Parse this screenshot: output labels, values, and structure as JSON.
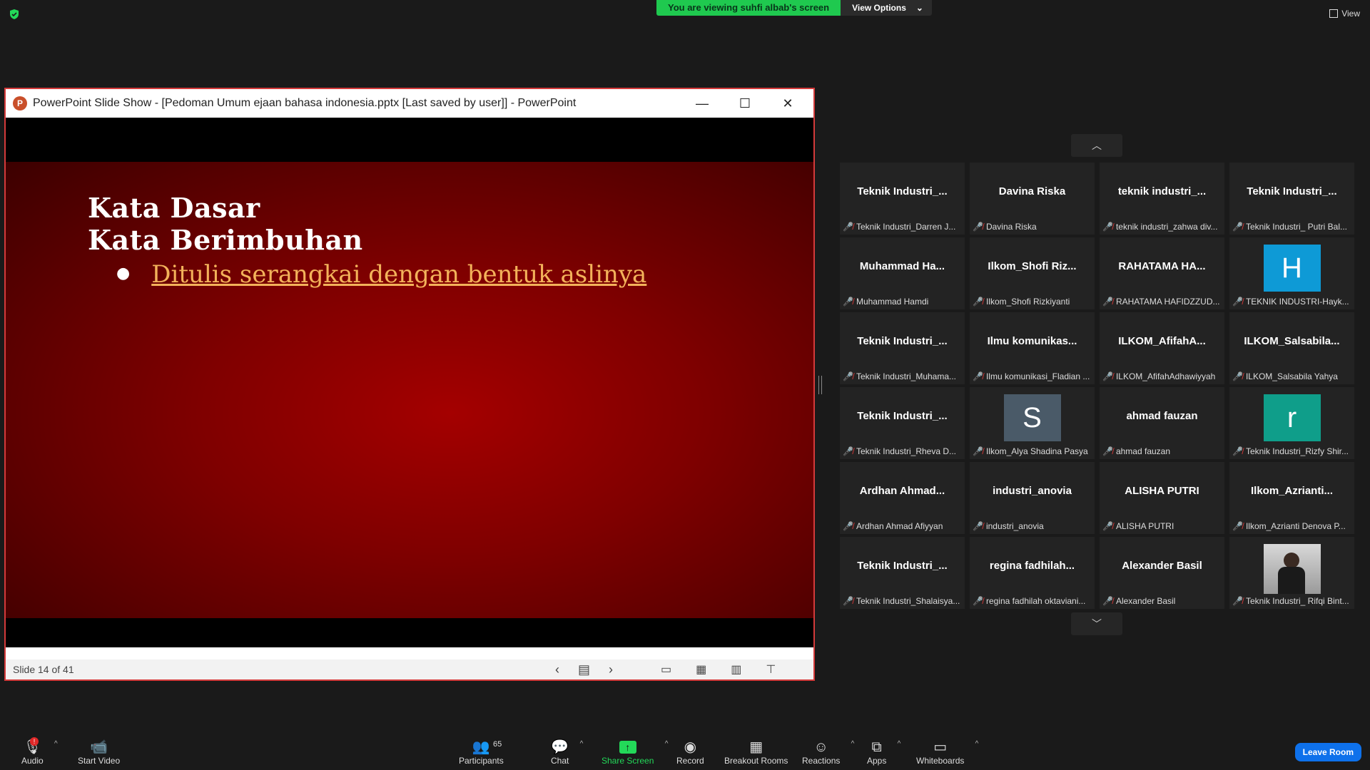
{
  "top": {
    "banner": "You are viewing suhfi albab's screen",
    "view_options": "View Options",
    "view": "View"
  },
  "ppt": {
    "title": "PowerPoint Slide Show - [Pedoman Umum ejaan bahasa indonesia.pptx [Last saved by user]] - PowerPoint",
    "slide_heading_1": "Kata Dasar",
    "slide_heading_2": "Kata Berimbuhan",
    "slide_bullet": "Ditulis serangkai dengan bentuk aslinya",
    "status": "Slide 14 of 41"
  },
  "gallery": [
    {
      "display": "Teknik  Industri_...",
      "name": "Teknik Industri_Darren J..."
    },
    {
      "display": "Davina Riska",
      "name": "Davina Riska"
    },
    {
      "display": "teknik  industri_...",
      "name": "teknik industri_zahwa div..."
    },
    {
      "display": "Teknik  Industri_...",
      "name": "Teknik Industri_ Putri Bal..."
    },
    {
      "display": "Muhammad  Ha...",
      "name": "Muhammad Hamdi"
    },
    {
      "display": "Ilkom_Shofi  Riz...",
      "name": "Ilkom_Shofi Rizkiyanti"
    },
    {
      "display": "RAHATAMA  HA...",
      "name": "RAHATAMA HAFIDZZUD..."
    },
    {
      "display": "",
      "name": "TEKNIK INDUSTRI-Hayk...",
      "avatar": "H",
      "color": "#0e9ad6"
    },
    {
      "display": "Teknik  Industri_...",
      "name": "Teknik Industri_Muhama..."
    },
    {
      "display": "Ilmu  komunikas...",
      "name": "Ilmu komunikasi_Fladian ..."
    },
    {
      "display": "ILKOM_AfifahA...",
      "name": "ILKOM_AfifahAdhawiyyah"
    },
    {
      "display": "ILKOM_Salsabila...",
      "name": "ILKOM_Salsabila Yahya"
    },
    {
      "display": "Teknik  Industri_...",
      "name": "Teknik Industri_Rheva D..."
    },
    {
      "display": "",
      "name": "Ilkom_Alya Shadina Pasya",
      "avatar": "S",
      "color": "#4a5a68"
    },
    {
      "display": "ahmad fauzan",
      "name": "ahmad fauzan"
    },
    {
      "display": "",
      "name": "Teknik Industri_Rizfy Shir...",
      "avatar": "r",
      "color": "#0f9e8a"
    },
    {
      "display": "Ardhan  Ahmad...",
      "name": "Ardhan Ahmad Afiyyan"
    },
    {
      "display": "industri_anovia",
      "name": "industri_anovia"
    },
    {
      "display": "ALISHA PUTRI",
      "name": "ALISHA PUTRI"
    },
    {
      "display": "Ilkom_Azrianti...",
      "name": "Ilkom_Azrianti Denova P..."
    },
    {
      "display": "Teknik  Industri_...",
      "name": "Teknik Industri_Shalaisya..."
    },
    {
      "display": "regina  fadhilah...",
      "name": "regina fadhilah oktaviani..."
    },
    {
      "display": "Alexander Basil",
      "name": "Alexander Basil"
    },
    {
      "display": "",
      "name": "Teknik Industri_ Rifqi Bint...",
      "photo": "true"
    }
  ],
  "toolbar": {
    "audio": "Audio",
    "audio_badge": "!",
    "start_video": "Start Video",
    "participants": "Participants",
    "participants_count": "65",
    "chat": "Chat",
    "share_screen": "Share Screen",
    "record": "Record",
    "breakout": "Breakout Rooms",
    "reactions": "Reactions",
    "apps": "Apps",
    "whiteboards": "Whiteboards",
    "leave": "Leave Room"
  },
  "colors": {
    "accent_green": "#23d959",
    "leave_blue": "#0e71eb",
    "share_border": "#d43a3a"
  }
}
